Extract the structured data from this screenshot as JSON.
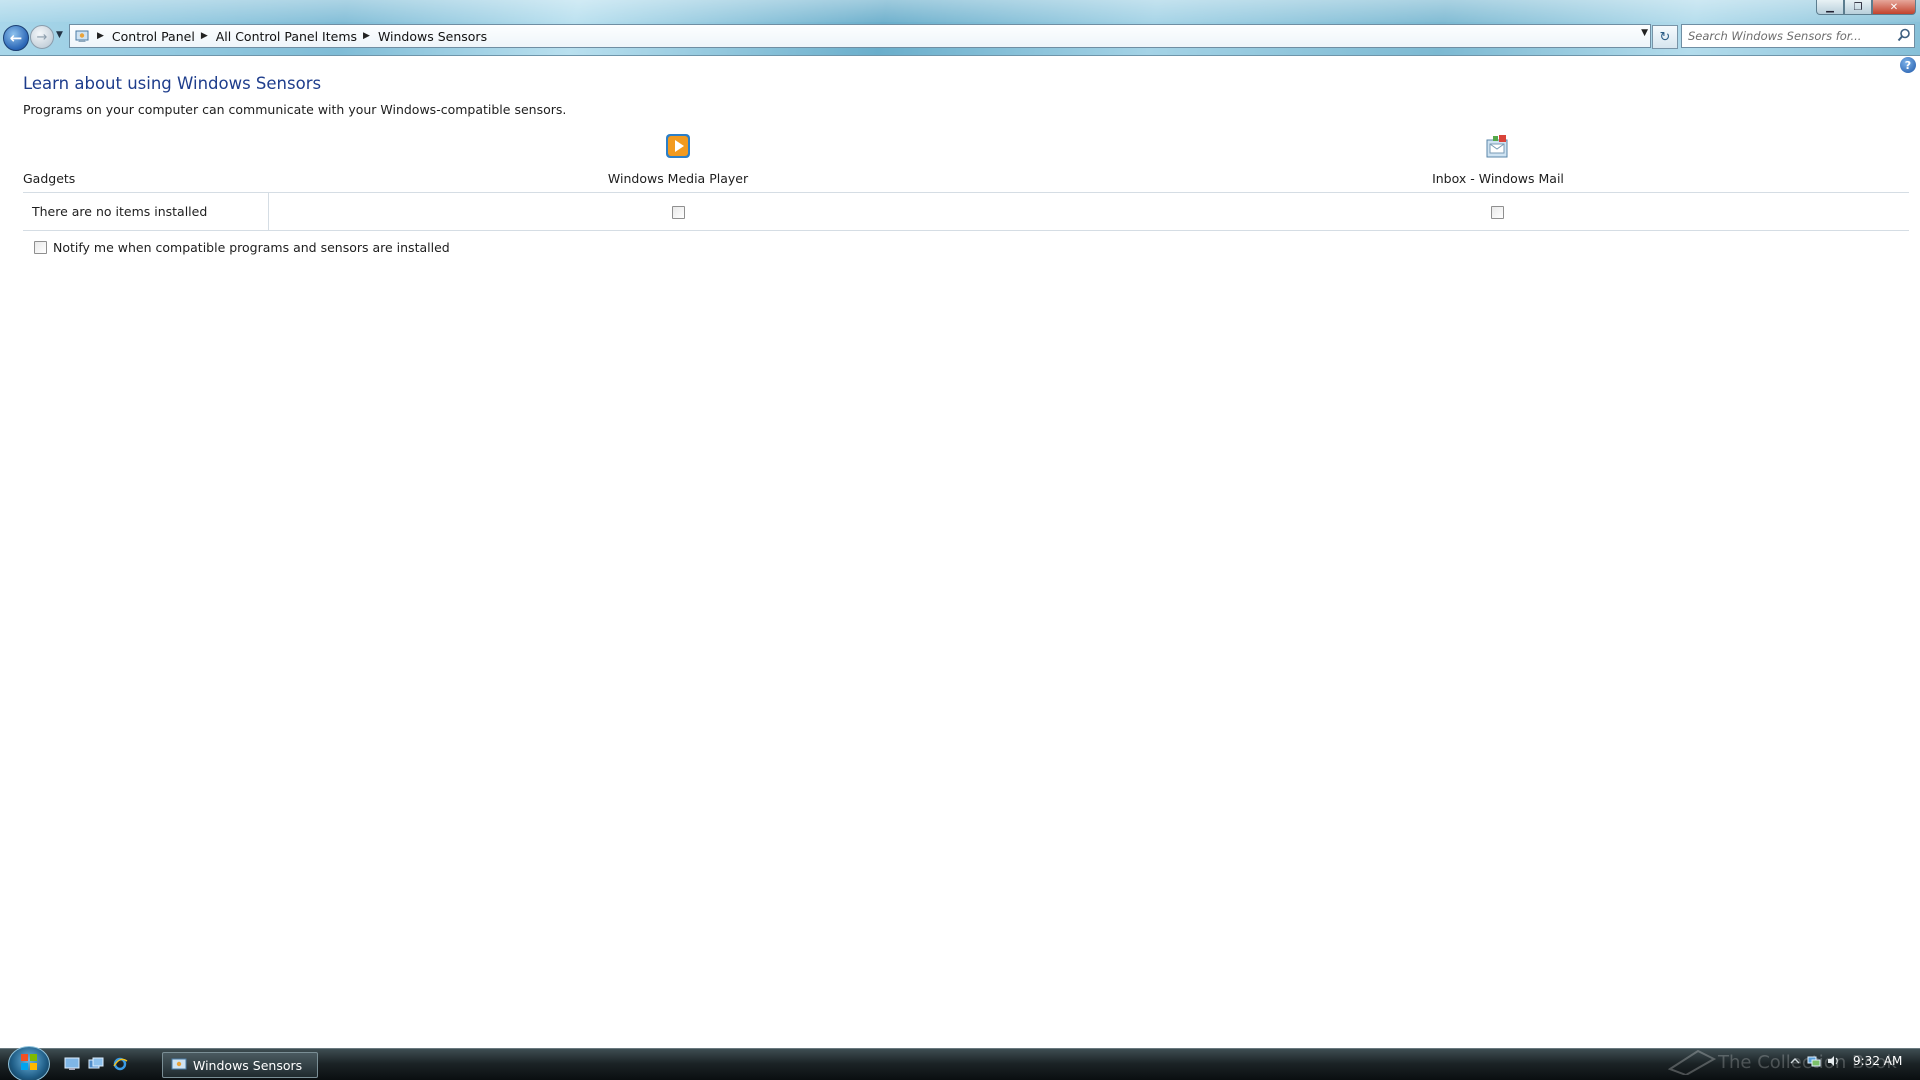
{
  "window": {
    "minimize_glyph": "▁",
    "maximize_glyph": "❐",
    "close_glyph": "✕"
  },
  "nav": {
    "back_icon": "back-arrow-icon",
    "forward_icon": "forward-arrow-icon",
    "back_glyph": "←",
    "forward_glyph": "→",
    "recent_glyph": "▼"
  },
  "address_bar": {
    "breadcrumbs": [
      "Control Panel",
      "All Control Panel Items",
      "Windows Sensors"
    ],
    "separator_glyph": "▶",
    "dropdown_glyph": "▼"
  },
  "refresh_glyph": "↻",
  "search": {
    "placeholder": "Search Windows Sensors for..."
  },
  "help_glyph": "?",
  "content": {
    "title": "Learn about using Windows Sensors",
    "description": "Programs on your computer can communicate with your Windows-compatible sensors.",
    "row_header": "Gadgets",
    "row_value": "There are no items installed",
    "programs": [
      {
        "name": "Windows Media Player",
        "icon": "media-player-icon",
        "checked": false
      },
      {
        "name": "Inbox - Windows Mail",
        "icon": "windows-mail-icon",
        "checked": false
      }
    ],
    "notify_label": "Notify me when compatible programs and sensors are installed",
    "notify_checked": false
  },
  "taskbar": {
    "task_label": "Windows Sensors",
    "watermark": "The Collection Book",
    "clock": "9:32 AM"
  },
  "colors": {
    "title_blue": "#1e3d8c",
    "accent": "#2a66b6",
    "taskbar": "#1b2326"
  }
}
